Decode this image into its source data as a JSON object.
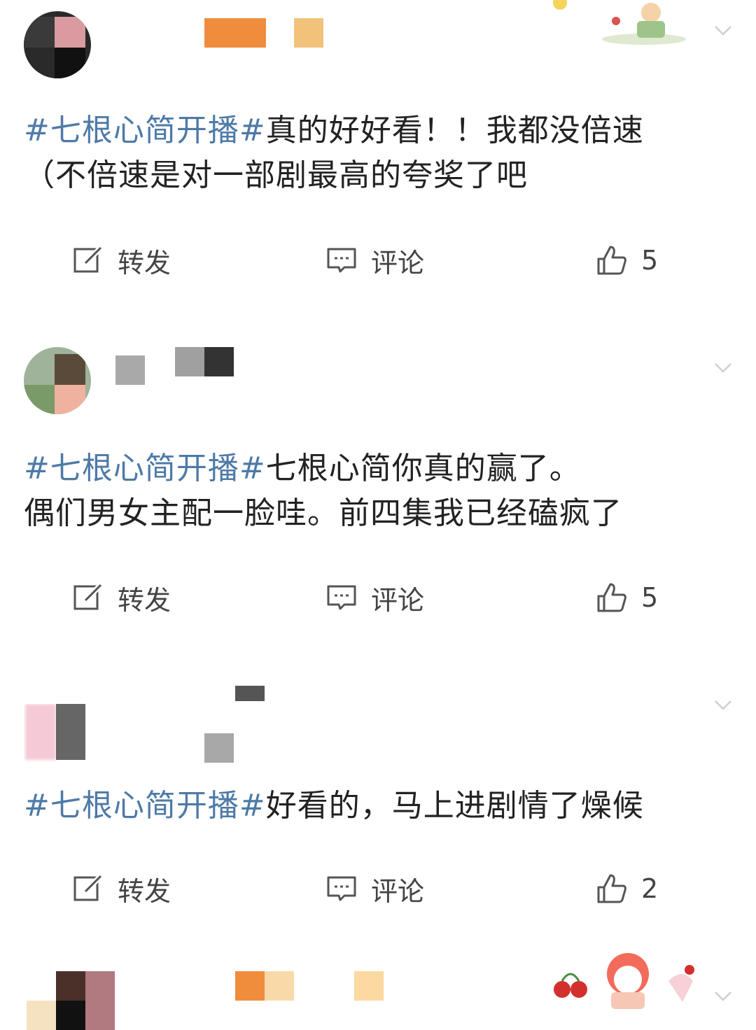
{
  "posts": [
    {
      "hashtag": "#七根心简开播#",
      "text_lines": [
        "真的好好看！！我都没倍速",
        "（不倍速是对一部剧最高的夸奖了吧"
      ],
      "actions": {
        "repost": "转发",
        "comment": "评论",
        "like_count": "5"
      }
    },
    {
      "hashtag": "#七根心简开播#",
      "text_lines": [
        "七根心简你真的赢了。",
        "偶们男女主配一脸哇。前四集我已经磕疯了"
      ],
      "actions": {
        "repost": "转发",
        "comment": "评论",
        "like_count": "5"
      }
    },
    {
      "hashtag": "#七根心简开播#",
      "text_lines": [
        "好看的，马上进剧情了燥候",
        ""
      ],
      "actions": {
        "repost": "转发",
        "comment": "评论",
        "like_count": "2"
      }
    }
  ],
  "colors": {
    "hashtag": "#4e7aa7",
    "text": "#222222",
    "icon": "#555555"
  },
  "icons": {
    "repost": "edit-share-icon",
    "comment": "comment-bubble-icon",
    "like": "thumbs-up-icon",
    "menu": "chevron-down-icon"
  }
}
